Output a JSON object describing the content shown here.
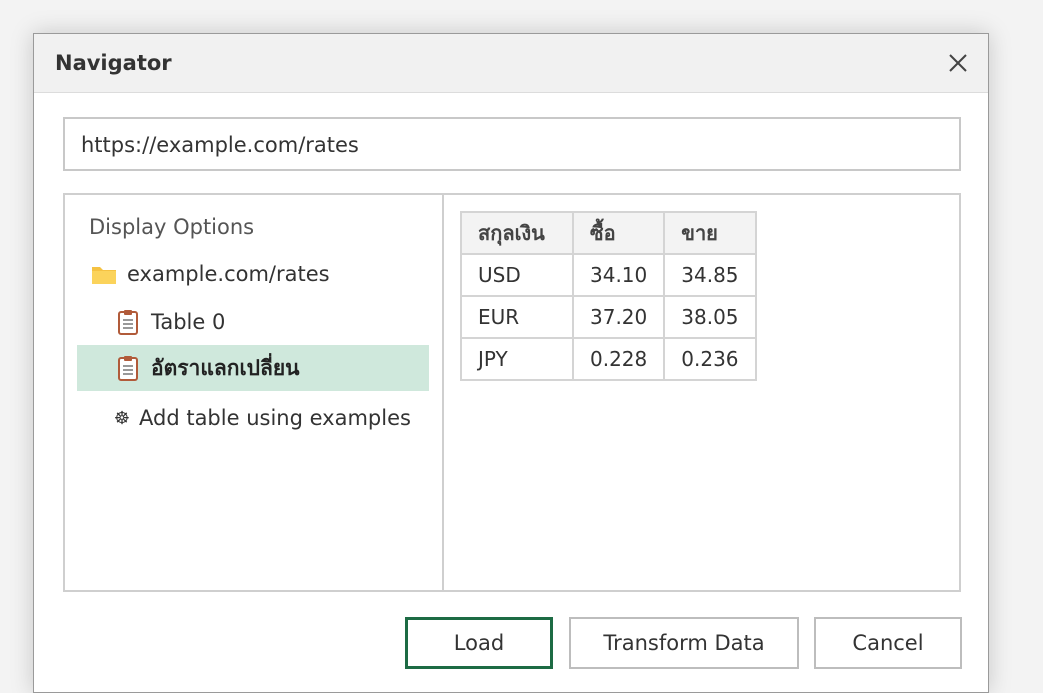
{
  "window": {
    "title": "Navigator"
  },
  "url": {
    "value": "https://example.com/rates"
  },
  "sidebar": {
    "heading": "Display Options",
    "items": [
      {
        "label": "example.com/rates",
        "icon": "folder-icon"
      },
      {
        "label": "Table 0",
        "icon": "table-icon"
      },
      {
        "label": "อัตราแลกเปลี่ยน",
        "icon": "table-icon",
        "selected": true
      },
      {
        "label": "Add table using examples",
        "icon": "examples-icon"
      }
    ]
  },
  "preview": {
    "columns": [
      "สกุลเงิน",
      "ซื้อ",
      "ขาย"
    ],
    "rows": [
      [
        "USD",
        "34.10",
        "34.85"
      ],
      [
        "EUR",
        "37.20",
        "38.05"
      ],
      [
        "JPY",
        "0.228",
        "0.236"
      ]
    ]
  },
  "buttons": {
    "load": "Load",
    "transform": "Transform Data",
    "cancel": "Cancel"
  },
  "colors": {
    "selection": "#cfe8dc",
    "primary_border": "#1d6b44",
    "folder": "#f5c242"
  }
}
